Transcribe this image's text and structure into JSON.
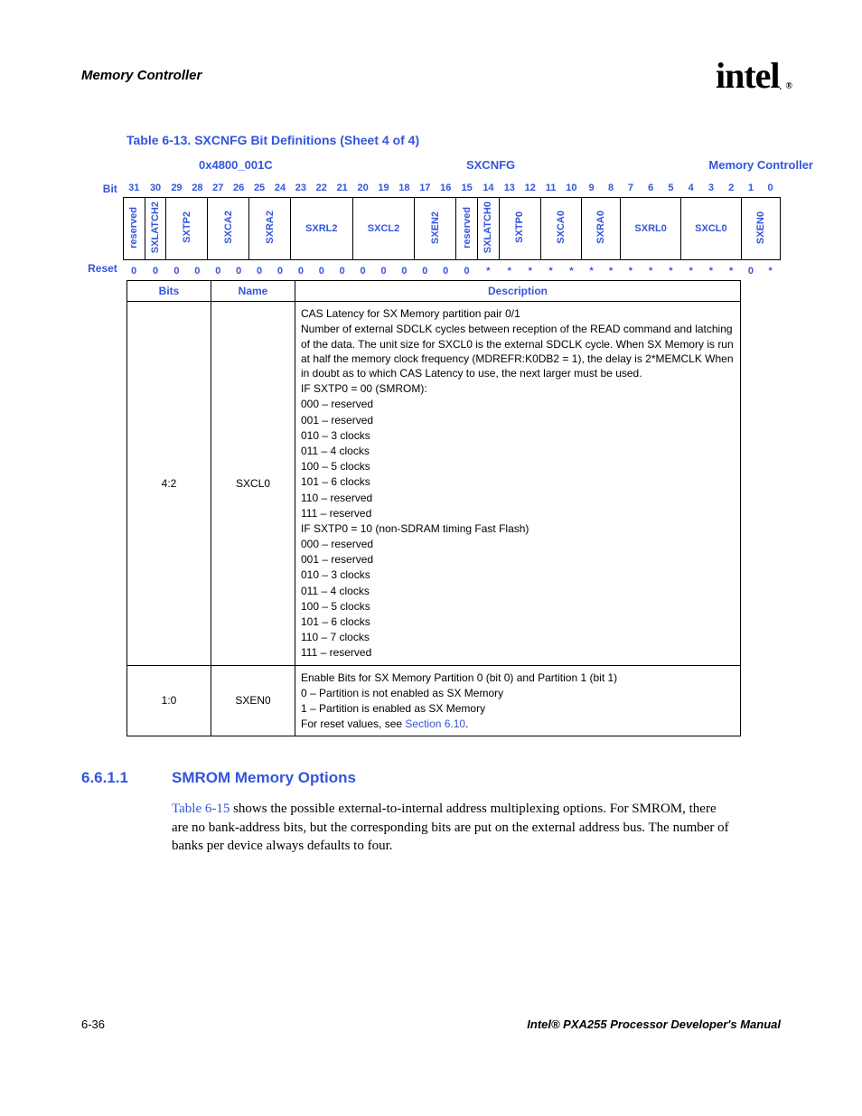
{
  "header": {
    "section": "Memory Controller",
    "logo_text": "intel",
    "logo_r": "®"
  },
  "table_title": "Table 6-13. SXCNFG Bit Definitions (Sheet 4 of 4)",
  "reg_header": {
    "addr": "0x4800_001C",
    "name": "SXCNFG",
    "owner": "Memory Controller"
  },
  "bits": [
    "31",
    "30",
    "29",
    "28",
    "27",
    "26",
    "25",
    "24",
    "23",
    "22",
    "21",
    "20",
    "19",
    "18",
    "17",
    "16",
    "15",
    "14",
    "13",
    "12",
    "11",
    "10",
    "9",
    "8",
    "7",
    "6",
    "5",
    "4",
    "3",
    "2",
    "1",
    "0"
  ],
  "fields": [
    {
      "label": "reserved",
      "span": 1
    },
    {
      "label": "SXLATCH2",
      "span": 1
    },
    {
      "label": "SXTP2",
      "span": 2
    },
    {
      "label": "SXCA2",
      "span": 2
    },
    {
      "label": "SXRA2",
      "span": 2
    },
    {
      "label": "SXRL2",
      "span": 3
    },
    {
      "label": "SXCL2",
      "span": 3
    },
    {
      "label": "SXEN2",
      "span": 2
    },
    {
      "label": "reserved",
      "span": 1
    },
    {
      "label": "SXLATCH0",
      "span": 1
    },
    {
      "label": "SXTP0",
      "span": 2
    },
    {
      "label": "SXCA0",
      "span": 2
    },
    {
      "label": "SXRA0",
      "span": 2
    },
    {
      "label": "SXRL0",
      "span": 3
    },
    {
      "label": "SXCL0",
      "span": 3
    },
    {
      "label": "SXEN0",
      "span": 2
    }
  ],
  "reset": [
    "0",
    "0",
    "0",
    "0",
    "0",
    "0",
    "0",
    "0",
    "0",
    "0",
    "0",
    "0",
    "0",
    "0",
    "0",
    "0",
    "0",
    "*",
    "*",
    "*",
    "*",
    "*",
    "*",
    "*",
    "*",
    "*",
    "*",
    "*",
    "*",
    "*",
    "0",
    "*"
  ],
  "labels": {
    "bit": "Bit",
    "reset": "Reset",
    "bits_h": "Bits",
    "name_h": "Name",
    "desc_h": "Description"
  },
  "rows": [
    {
      "bits": "4:2",
      "name": "SXCL0",
      "desc": [
        "CAS Latency for SX Memory partition pair 0/1",
        "Number of external SDCLK cycles between reception of the READ command and latching of the data. The unit size for SXCL0 is the external SDCLK cycle. When SX Memory is run at half the memory clock frequency (MDREFR:K0DB2 = 1), the delay is 2*MEMCLK When in doubt as to which CAS Latency to use, the next larger must be used.",
        "IF SXTP0 = 00 (SMROM):",
        "000 – reserved",
        "001 – reserved",
        "010 – 3 clocks",
        "011 – 4 clocks",
        "100 – 5 clocks",
        "101 – 6 clocks",
        "110 – reserved",
        "111 – reserved",
        "IF SXTP0 = 10 (non-SDRAM timing Fast Flash)",
        "000 – reserved",
        "001 – reserved",
        "010 – 3 clocks",
        "011 – 4 clocks",
        "100 – 5 clocks",
        "101 – 6 clocks",
        "110 – 7 clocks",
        "111 – reserved"
      ]
    },
    {
      "bits": "1:0",
      "name": "SXEN0",
      "desc": [
        "Enable Bits for SX Memory Partition 0 (bit 0) and Partition 1 (bit 1)",
        "0 –  Partition is not enabled as SX Memory",
        "1 –  Partition is enabled as SX Memory",
        "For reset values, see Section 6.10."
      ],
      "link_idx": 3,
      "link_text": "Section 6.10"
    }
  ],
  "section": {
    "num": "6.6.1.1",
    "title": "SMROM Memory Options",
    "body_pre": "",
    "body_link": "Table 6-15",
    "body_post": " shows the possible external-to-internal address multiplexing options. For SMROM, there are no bank-address bits, but the corresponding bits are put on the external address bus. The number of banks per device always defaults to four."
  },
  "footer": {
    "page": "6-36",
    "doc": "Intel® PXA255 Processor Developer's Manual"
  }
}
